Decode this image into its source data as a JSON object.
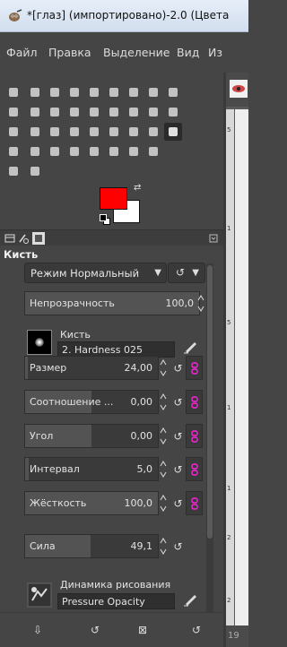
{
  "window": {
    "title": "*[глаз] (импортировано)-2.0 (Цвета"
  },
  "menu": [
    "Файл",
    "Правка",
    "Выделение",
    "Вид",
    "Из"
  ],
  "colors": {
    "foreground": "#ff0000",
    "background": "#ffffff"
  },
  "toolbox": {
    "icons": [
      "rect-select-icon",
      "ellipse-select-icon",
      "lasso-icon",
      "fuzzy-select-icon",
      "by-color-select-icon",
      "scissors-icon",
      "foreground-select-icon",
      "paths-icon",
      "color-picker-icon",
      "zoom-icon",
      "measure-icon",
      "move-icon",
      "align-icon",
      "crop-icon",
      "unified-transform-icon",
      "rotate-icon",
      "shear-icon",
      "perspective-icon",
      "flip-icon",
      "cage-icon",
      "warp-icon",
      "handle-transform-icon",
      "text-icon",
      "bucket-fill-icon",
      "gradient-icon",
      "pencil-icon",
      "paintbrush-icon",
      "eraser-icon",
      "airbrush-icon",
      "ink-icon",
      "mypaint-brush-icon",
      "clone-icon",
      "heal-icon",
      "perspective-clone-icon",
      "blur-icon",
      "smudge-icon",
      "dodge-burn-icon"
    ]
  },
  "panel": {
    "title": "Кисть",
    "mode": "Режим Нормальный",
    "opacity": {
      "label": "Непрозрачность",
      "value": "100,0",
      "fraction": 1.0
    },
    "brush": {
      "label": "Кисть",
      "name": "2. Hardness 025"
    },
    "sliders": [
      {
        "label": "Размер",
        "value": "24,00",
        "fraction": 0.02
      },
      {
        "label": "Соотношение ...",
        "value": "0,00",
        "fraction": 0.5
      },
      {
        "label": "Угол",
        "value": "0,00",
        "fraction": 0.5
      },
      {
        "label": "Интервал",
        "value": "5,0",
        "fraction": 0.025
      },
      {
        "label": "Жёсткость",
        "value": "100,0",
        "fraction": 1.0
      },
      {
        "label": "Сила",
        "value": "49,1",
        "fraction": 0.49
      }
    ],
    "dynamics": {
      "label": "Динамика рисования",
      "name": "Pressure Opacity"
    }
  },
  "canvas": {
    "ruler_labels": [
      "5",
      "1",
      "5",
      "1",
      "1",
      "2",
      "2"
    ],
    "status_text": "19"
  }
}
